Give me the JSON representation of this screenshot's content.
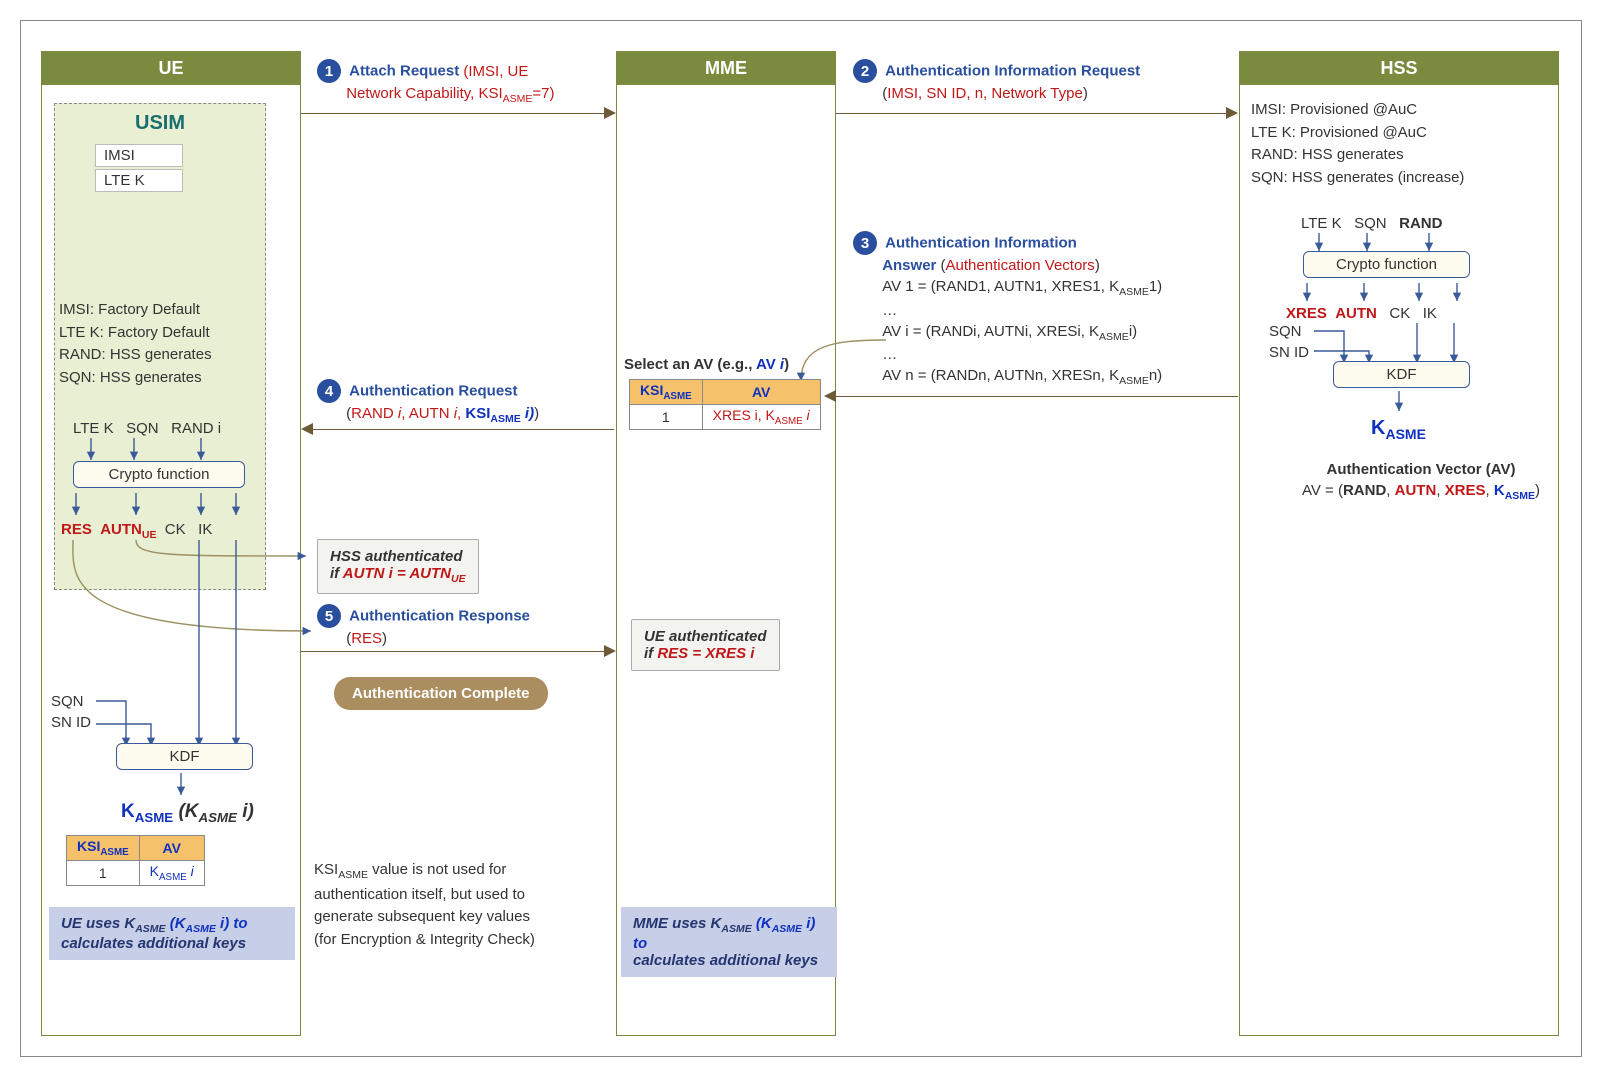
{
  "lanes": {
    "ue": "UE",
    "mme": "MME",
    "hss": "HSS"
  },
  "usim": {
    "title": "USIM",
    "imsi": "IMSI",
    "ltek": "LTE K"
  },
  "ue_provision": {
    "l1": "IMSI: Factory Default",
    "l2": "LTE K: Factory Default",
    "l3": "RAND: HSS generates",
    "l4": "SQN: HSS generates"
  },
  "ue_crypto_in": {
    "a": "LTE K",
    "b": "SQN",
    "c": "RAND i"
  },
  "ue_crypto_label": "Crypto function",
  "ue_crypto_out": {
    "a": "RES",
    "b": "AUTN",
    "b_sub": "UE",
    "c": "CK",
    "d": "IK"
  },
  "ue_kdf_in": {
    "a": "SQN",
    "b": "SN ID"
  },
  "ue_kdf_label": "KDF",
  "ue_kasme": {
    "a": "K",
    "a_sub": "ASME",
    "b": "(K",
    "b_sub": "ASME",
    "c": " i)"
  },
  "ue_table": {
    "h1": "KSI",
    "h1_sub": "ASME",
    "h2": "AV",
    "v1": "1",
    "v2": "K",
    "v2_sub": "ASME",
    "v2_suf": " i"
  },
  "ue_note": {
    "a": "UE uses K",
    "a_sub": "ASME",
    "b": " (K",
    "b_sub": "ASME",
    "c": " i) to",
    "d": "calculates additional keys"
  },
  "step1": {
    "title": "Attach Request",
    "p": "(IMSI, UE",
    "p2": "Network Capability, KSI",
    "p2_sub": "ASME",
    "p3": "=7)"
  },
  "step2": {
    "title": "Authentication Information Request",
    "p": "(",
    "p2": "IMSI, SN ID, n, Network Type",
    "p3": ")"
  },
  "step3": {
    "title": "Authentication Information",
    "title2": "Answer",
    "p": "(Authentication Vectors)",
    "av1": "AV 1 = (RAND1, AUTN1, XRES1, K",
    "av1_sub": "ASME",
    "av1e": "1)",
    "dots": "…",
    "avi": "AV i = (RANDi, AUTNi, XRESi, K",
    "avi_sub": "ASME",
    "avie": "i)",
    "avn": "AV n = (RANDn, AUTNn, XRESn, K",
    "avn_sub": "ASME",
    "avne": "n)"
  },
  "step4": {
    "title": "Authentication Request",
    "p": "(RAND i, AUTN i, ",
    "p2": "KSI",
    "p2_sub": "ASME",
    "p3": " i)"
  },
  "step5": {
    "title": "Authentication Response",
    "p": "(",
    "p2": "RES",
    "p3": ")"
  },
  "mme_select": "Select an AV (e.g.,  AV i)",
  "mme_table": {
    "h1": "KSI",
    "h1_sub": "ASME",
    "h2": "AV",
    "v1": "1",
    "v2a": "XRES i, K",
    "v2_sub": "ASME",
    "v2_suf": " i"
  },
  "hss_auth_note": {
    "a": "HSS authenticated",
    "b": "if AUTN i = AUTN",
    "b_sub": "UE"
  },
  "ue_auth_note": {
    "a": "UE authenticated",
    "b": "if RES = XRES i"
  },
  "auth_complete": "Authentication Complete",
  "ksi_explain": {
    "a": "KSI",
    "a_sub": "ASME",
    "b": " value is not used for",
    "c": "authentication itself, but used to",
    "d": "generate subsequent key values",
    "e": "(for Encryption & Integrity Check)"
  },
  "mme_note": {
    "a": "MME uses K",
    "a_sub": "ASME",
    "b": " (K",
    "b_sub": "ASME",
    "c": " i) to",
    "d": "calculates additional keys"
  },
  "hss_provision": {
    "l1": "IMSI: Provisioned @AuC",
    "l2": "LTE K: Provisioned @AuC",
    "l3": "RAND: HSS generates",
    "l4": "SQN: HSS generates (increase)"
  },
  "hss_crypto_in": {
    "a": "LTE K",
    "b": "SQN",
    "c": "RAND"
  },
  "hss_crypto_label": "Crypto function",
  "hss_crypto_out": {
    "a": "XRES",
    "b": "AUTN",
    "c": "CK",
    "d": "IK"
  },
  "hss_kdf_in": {
    "a": "SQN",
    "b": "SN ID"
  },
  "hss_kdf_label": "KDF",
  "hss_kasme": {
    "a": "K",
    "a_sub": "ASME"
  },
  "hss_av_title": "Authentication Vector (AV)",
  "hss_av": {
    "a": "AV = (",
    "b": "RAND",
    "c": ", ",
    "d": "AUTN",
    "e": ", ",
    "f": "XRES",
    "g": ", ",
    "h": "K",
    "h_sub": "ASME",
    "i": ")"
  }
}
